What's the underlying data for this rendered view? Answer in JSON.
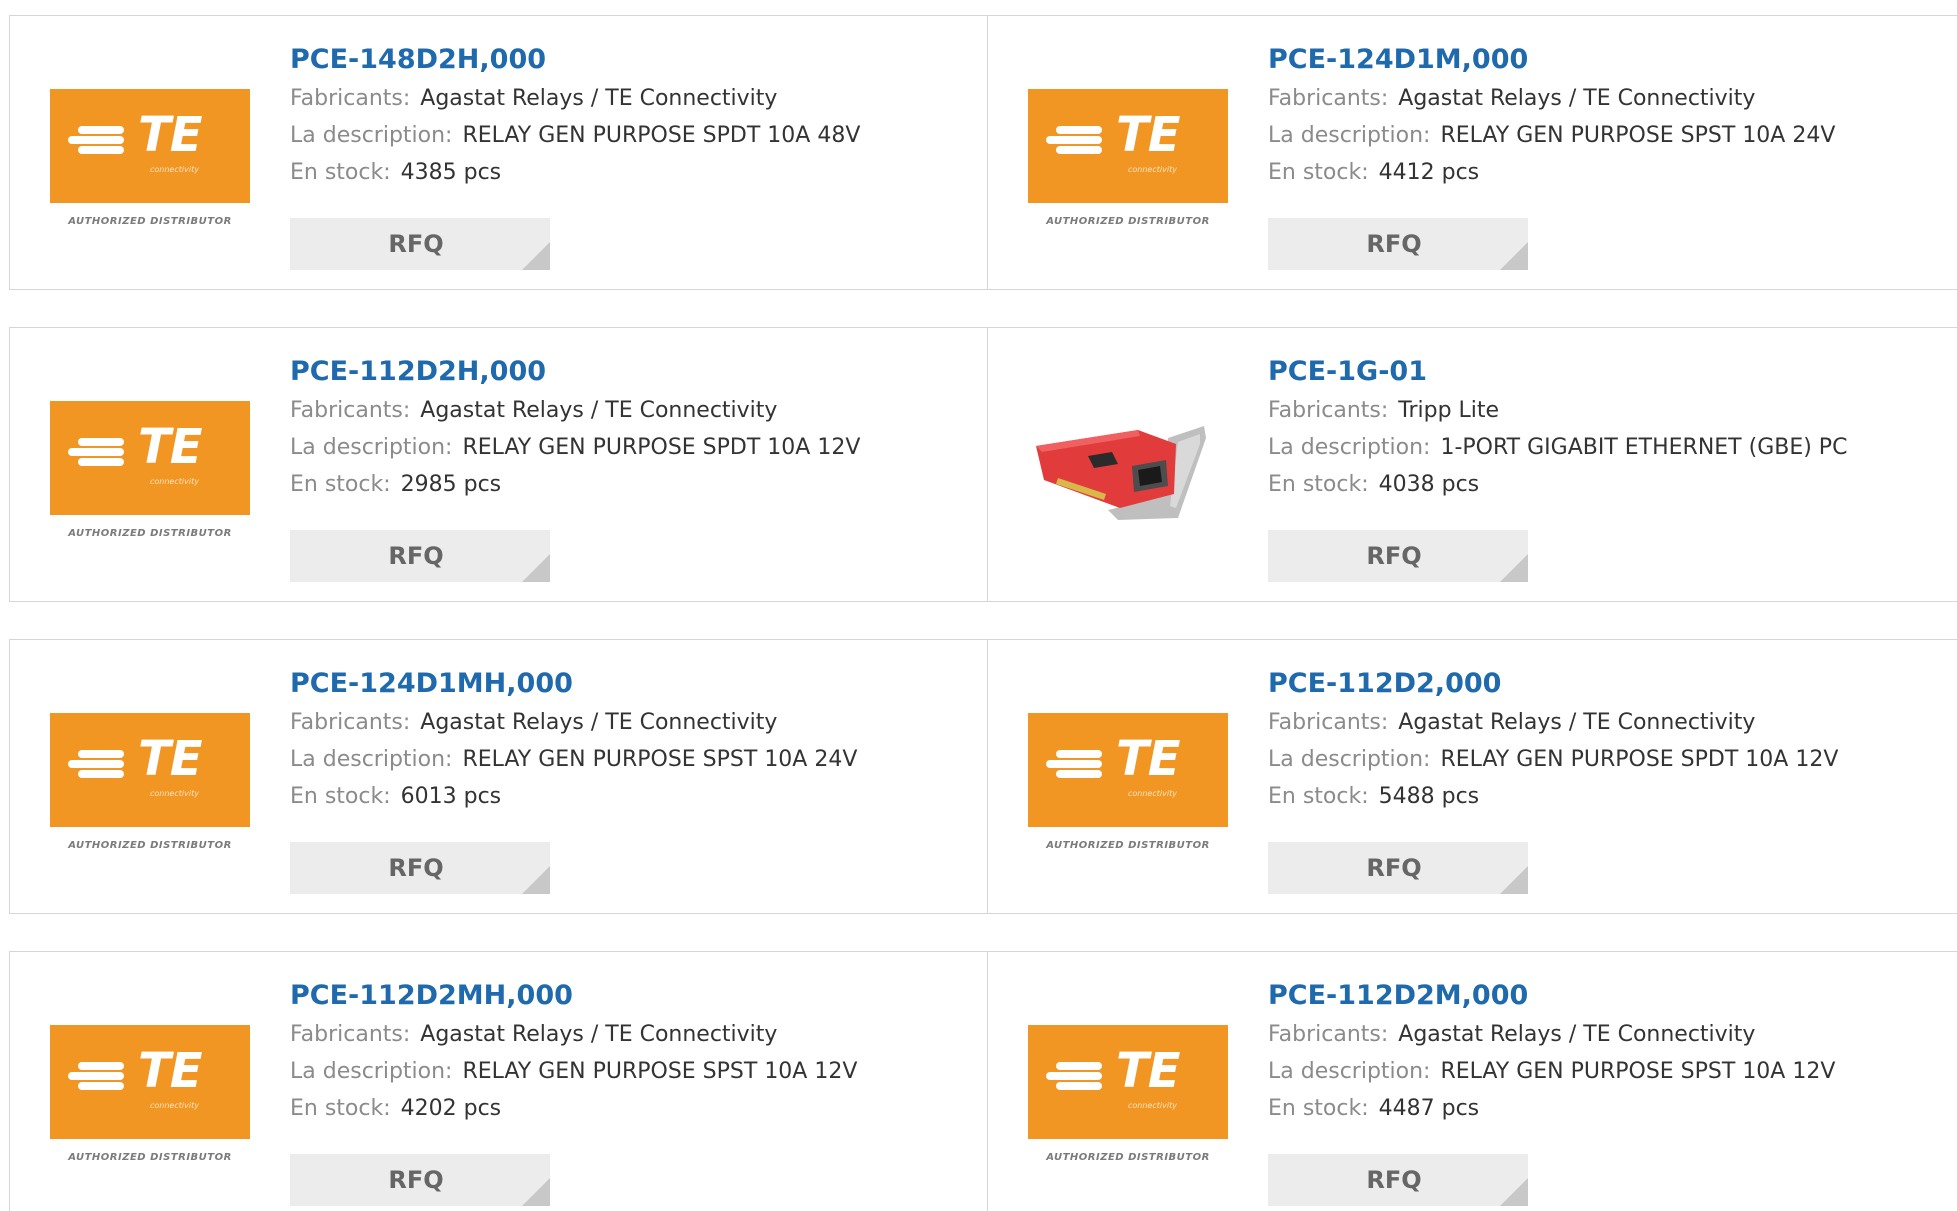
{
  "labels": {
    "manufacturer": "Fabricants:",
    "description": "La description:",
    "stock": "En stock:",
    "rfq": "RFQ"
  },
  "logo": {
    "brand": "TE",
    "tagline": "connectivity",
    "authorized": "AUTHORIZED DISTRIBUTOR"
  },
  "products": [
    {
      "pn": "PCE-148D2H,000",
      "manufacturer": "Agastat Relays / TE Connectivity",
      "description": "RELAY GEN PURPOSE SPDT 10A 48V",
      "stock": "4385 pcs",
      "image": "te-logo"
    },
    {
      "pn": "PCE-124D1M,000",
      "manufacturer": "Agastat Relays / TE Connectivity",
      "description": "RELAY GEN PURPOSE SPST 10A 24V",
      "stock": "4412 pcs",
      "image": "te-logo"
    },
    {
      "pn": "PCE-112D2H,000",
      "manufacturer": "Agastat Relays / TE Connectivity",
      "description": "RELAY GEN PURPOSE SPDT 10A 12V",
      "stock": "2985 pcs",
      "image": "te-logo"
    },
    {
      "pn": "PCE-1G-01",
      "manufacturer": "Tripp Lite",
      "description": "1-PORT GIGABIT ETHERNET (GBE) PC",
      "stock": "4038 pcs",
      "image": "network-card"
    },
    {
      "pn": "PCE-124D1MH,000",
      "manufacturer": "Agastat Relays / TE Connectivity",
      "description": "RELAY GEN PURPOSE SPST 10A 24V",
      "stock": "6013 pcs",
      "image": "te-logo"
    },
    {
      "pn": "PCE-112D2,000",
      "manufacturer": "Agastat Relays / TE Connectivity",
      "description": "RELAY GEN PURPOSE SPDT 10A 12V",
      "stock": "5488 pcs",
      "image": "te-logo"
    },
    {
      "pn": "PCE-112D2MH,000",
      "manufacturer": "Agastat Relays / TE Connectivity",
      "description": "RELAY GEN PURPOSE SPST 10A 12V",
      "stock": "4202 pcs",
      "image": "te-logo"
    },
    {
      "pn": "PCE-112D2M,000",
      "manufacturer": "Agastat Relays / TE Connectivity",
      "description": "RELAY GEN PURPOSE SPST 10A 12V",
      "stock": "4487 pcs",
      "image": "te-logo"
    }
  ],
  "colors": {
    "link": "#1f69ad",
    "brand_orange": "#f29623",
    "label": "#8b8b8b",
    "rfq_bg": "#ececec"
  }
}
